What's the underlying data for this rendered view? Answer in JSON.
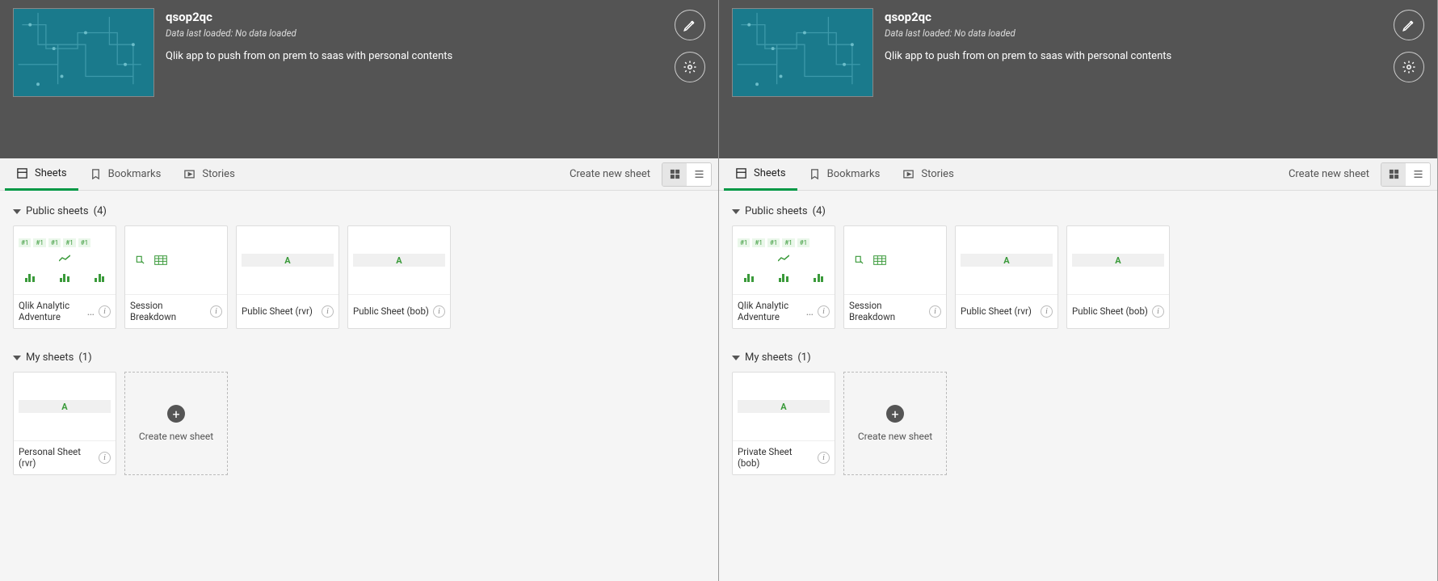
{
  "app": {
    "title": "qsop2qc",
    "last_loaded": "Data last loaded: No data loaded",
    "description": "Qlik app to push from on prem to saas with personal contents"
  },
  "tabs": {
    "sheets": "Sheets",
    "bookmarks": "Bookmarks",
    "stories": "Stories"
  },
  "create_new_sheet": "Create new sheet",
  "sections": {
    "public": {
      "label": "Public sheets",
      "count": "(4)"
    },
    "my": {
      "label": "My sheets",
      "count": "(1)"
    }
  },
  "kpi_tag": "#1",
  "sheets_public": [
    {
      "label": "Qlik Analytic Adventure"
    },
    {
      "label": "Session Breakdown"
    },
    {
      "label": "Public Sheet (rvr)"
    },
    {
      "label": "Public Sheet (bob)"
    }
  ],
  "left_my_sheet": {
    "label": "Personal Sheet (rvr)"
  },
  "right_my_sheet": {
    "label": "Private Sheet (bob)"
  },
  "new_sheet_card": "Create new sheet"
}
